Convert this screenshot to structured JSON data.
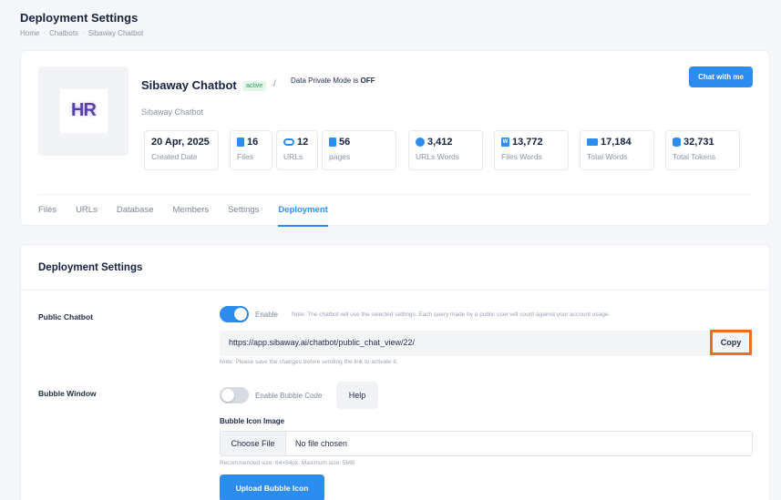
{
  "page": {
    "title": "Deployment Settings",
    "breadcrumb": [
      "Home",
      "Chatbots",
      "Sibaway Chatbot"
    ]
  },
  "bot": {
    "name": "Sibaway Chatbot",
    "status": "active",
    "separator": "/",
    "private_mode_label": "Data Private Mode is",
    "private_mode_value": "OFF",
    "subtitle": "Sibaway Chatbot",
    "chat_button": "Chat with me",
    "logo_text": "HR"
  },
  "stats": [
    {
      "value": "20 Apr, 2025",
      "label": "Created Date",
      "icon": "none"
    },
    {
      "value": "16",
      "label": "Files",
      "icon": "file-icon"
    },
    {
      "value": "12",
      "label": "URLs",
      "icon": "link-icon"
    },
    {
      "value": "56",
      "label": "pages",
      "icon": "page-icon"
    },
    {
      "value": "3,412",
      "label": "URLs Words",
      "icon": "globe-icon"
    },
    {
      "value": "13,772",
      "label": "Files Words",
      "icon": "word-icon"
    },
    {
      "value": "17,184",
      "label": "Total Words",
      "icon": "keyboard-icon"
    },
    {
      "value": "32,731",
      "label": "Total Tokens",
      "icon": "database-icon"
    }
  ],
  "tabs": [
    {
      "label": "Files",
      "active": false
    },
    {
      "label": "URLs",
      "active": false
    },
    {
      "label": "Database",
      "active": false
    },
    {
      "label": "Members",
      "active": false
    },
    {
      "label": "Settings",
      "active": false
    },
    {
      "label": "Deployment",
      "active": true
    }
  ],
  "deployment": {
    "section_title": "Deployment Settings",
    "public_chatbot": {
      "label": "Public Chatbot",
      "toggle_on": true,
      "toggle_label": "Enable",
      "note": "Note: The chatbot will use the selected settings. Each query made by a public user will count against your account usage.",
      "url": "https://app.sibaway.ai/chatbot/public_chat_view/22/",
      "copy_label": "Copy",
      "save_note": "Note: Please save the changes before sending the link to activate it."
    },
    "bubble_window": {
      "label": "Bubble Window",
      "toggle_on": false,
      "toggle_label": "Enable Bubble Code",
      "help_label": "Help",
      "icon_image_label": "Bubble Icon Image",
      "choose_file_label": "Choose File",
      "no_file_label": "No file chosen",
      "size_note": "Recommended size: 64×64px. Maximum size: 5MB",
      "upload_label": "Upload Bubble Icon"
    }
  },
  "colors": {
    "accent": "#2d8cf0",
    "highlight": "#f26d21",
    "active_badge": "#2e9e5b"
  }
}
